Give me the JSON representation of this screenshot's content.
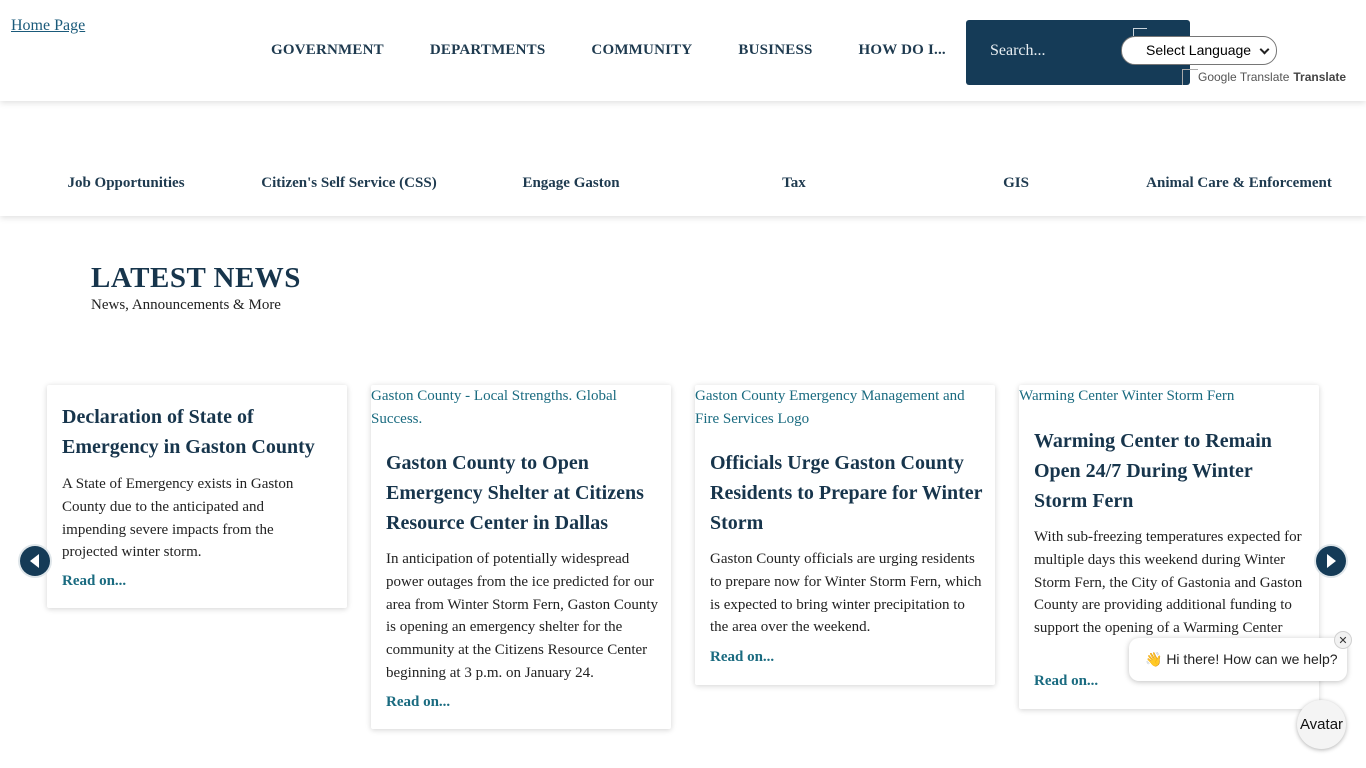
{
  "header": {
    "logo_alt": "Home Page",
    "nav": [
      "GOVERNMENT",
      "DEPARTMENTS",
      "COMMUNITY",
      "BUSINESS",
      "HOW DO I..."
    ],
    "search_placeholder": "Search...",
    "language_select": "Select Language",
    "google_translate_alt": "Google Translate",
    "translate_label": "Translate"
  },
  "quicklinks": [
    "Job Opportunities",
    "Citizen's Self Service (CSS)",
    "Engage Gaston",
    "Tax",
    "GIS",
    "Animal Care & Enforcement"
  ],
  "news": {
    "heading": "LATEST NEWS",
    "subheading": "News, Announcements & More",
    "cards": [
      {
        "image_alt": "",
        "title": "Declaration of State of Emergency in Gaston County",
        "text": "A State of Emergency exists in Gaston County due to the anticipated and impending severe impacts from the projected winter storm.",
        "link": "Read on..."
      },
      {
        "image_alt": "Gaston County - Local Strengths. Global Success.",
        "title": "Gaston County to Open Emergency Shelter at Citizens Resource Center in Dallas",
        "text": "In anticipation of potentially widespread power outages from the ice predicted for our area from Winter Storm Fern, Gaston County is opening an emergency shelter for the community at the Citizens Resource Center beginning at 3 p.m. on January 24.",
        "link": "Read on..."
      },
      {
        "image_alt": "Gaston County Emergency Management and Fire Services Logo",
        "title": "Officials Urge Gaston County Residents to Prepare for Winter Storm",
        "text": "Gaston County officials are urging residents to prepare now for Winter Storm Fern, which is expected to bring winter precipitation to the area over the weekend.",
        "link": "Read on..."
      },
      {
        "image_alt": "Warming Center Winter Storm Fern",
        "title": "Warming Center to Remain Open 24/7 During Winter Storm Fern",
        "text": "With sub-freezing temperatures expected for multiple days this weekend during Winter Storm Fern, the City of Gastonia and Gaston County are providing additional funding to support the opening of a Warming Center",
        "link": "Read on..."
      }
    ]
  },
  "chat": {
    "greeting": "👋 Hi there! How can we help?",
    "close": "✕",
    "avatar_label": "Avatar"
  },
  "colors": {
    "navy": "#153b57",
    "heading": "#17354c",
    "link": "#1a6b80"
  }
}
